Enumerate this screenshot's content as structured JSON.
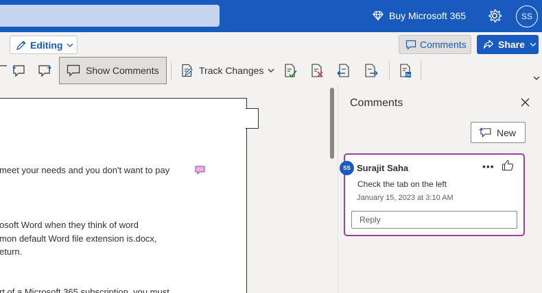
{
  "topbar": {
    "buy_label": "Buy Microsoft 365",
    "avatar_initials": "SS",
    "accent": "#185abd"
  },
  "toolbar": {
    "editing_label": "Editing",
    "comments_label": "Comments",
    "share_label": "Share"
  },
  "ribbon": {
    "show_comments_label": "Show Comments",
    "track_changes_label": "Track Changes",
    "icons": [
      "previous-comment-icon",
      "next-comment-icon",
      "accept-change-icon",
      "reject-change-icon",
      "previous-change-icon",
      "next-change-icon",
      "linkedin-resume-icon"
    ]
  },
  "document": {
    "lines": [
      "meet your needs and you don't want to pay",
      "osoft Word when they think of word",
      "mon default Word file extension is.docx,",
      "eturn.",
      "rt of a Microsoft 365 subscription, you must"
    ]
  },
  "comments_pane": {
    "title": "Comments",
    "new_label": "New",
    "comment": {
      "avatar_initials": "SS",
      "author": "Surajit Saha",
      "text": "Check the tab on the left",
      "date": "January 15, 2023 at 3:10 AM",
      "reply_placeholder": "Reply",
      "border_color": "#9c3f9e"
    }
  }
}
